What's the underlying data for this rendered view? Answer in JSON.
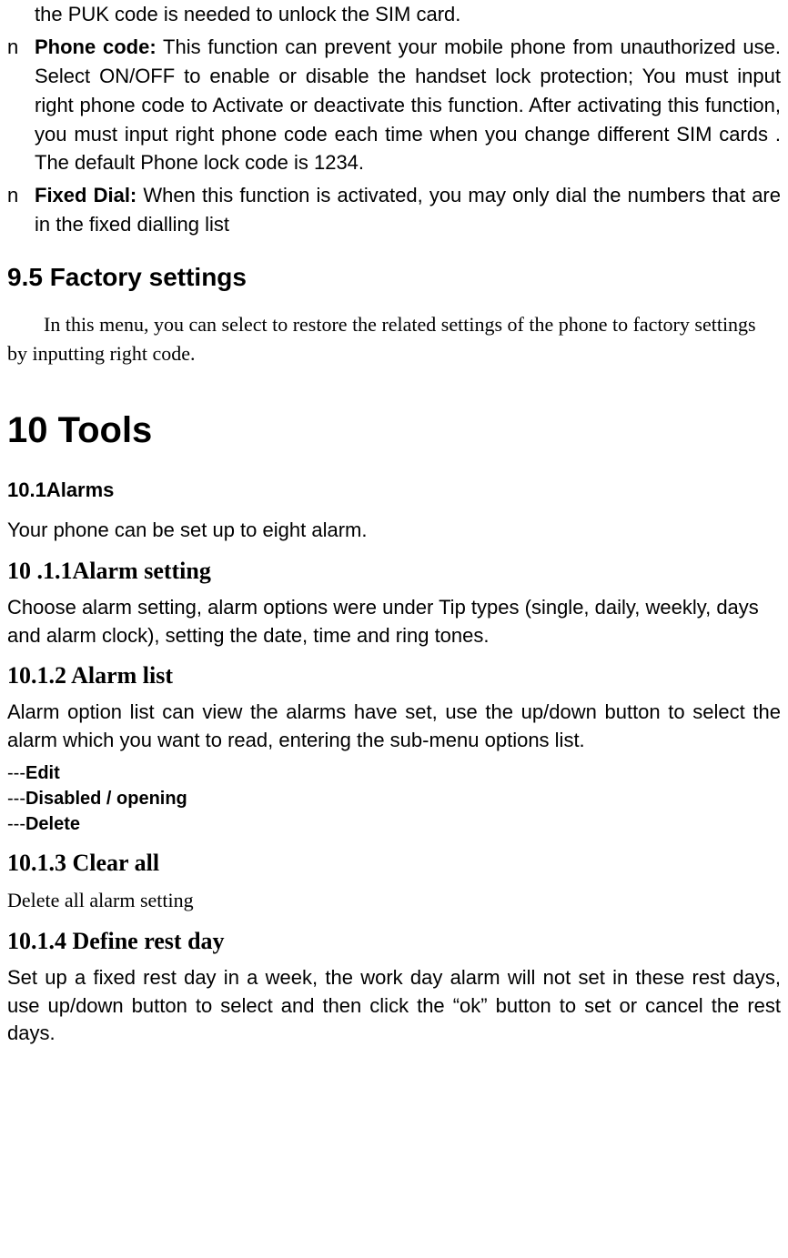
{
  "topContinuation": "the PUK code is needed to unlock the SIM card.",
  "bullets": [
    {
      "marker": "n",
      "boldLabel": "Phone code:",
      "rest": " This function can prevent your mobile phone from unauthorized use. Select ON/OFF to enable or disable the handset lock protection; You must input right phone code to Activate or deactivate this function. After activating this function, you must input right phone code each time when you change different SIM cards . The default Phone lock code is 1234."
    },
    {
      "marker": "n",
      "boldLabel": "Fixed Dial:",
      "rest": " When this function is activated, you may only dial the numbers that are in the fixed dialling list"
    }
  ],
  "section95": {
    "title": "9.5 Factory settings",
    "body": "In this menu, you can select to restore the related settings of the phone to factory settings by inputting right code."
  },
  "section10": {
    "title": "10 Tools",
    "alarms": {
      "title": "10.1Alarms",
      "intro": "Your phone can be set up to eight alarm.",
      "s1": {
        "title": "10 .1.1Alarm setting",
        "body": "Choose alarm setting, alarm options were under Tip types (single, daily, weekly, days and alarm clock), setting the date, time and ring tones."
      },
      "s2": {
        "title": "10.1.2 Alarm list",
        "body": "Alarm option list can view the alarms have set, use the up/down button to select the alarm which you want to read, entering the sub-menu options list.",
        "items": [
          {
            "dashes": "---",
            "label": "Edit"
          },
          {
            "dashes": "---",
            "label": "Disabled / opening"
          },
          {
            "dashes": "---",
            "label": "Delete"
          }
        ]
      },
      "s3": {
        "title": "10.1.3 Clear all",
        "body": "Delete all alarm setting"
      },
      "s4": {
        "title": "10.1.4 Define rest day",
        "body": "Set up a fixed rest day in a week, the work day alarm will not set in these rest days, use up/down button to select and then click the “ok” button to set or cancel the rest days."
      }
    }
  }
}
